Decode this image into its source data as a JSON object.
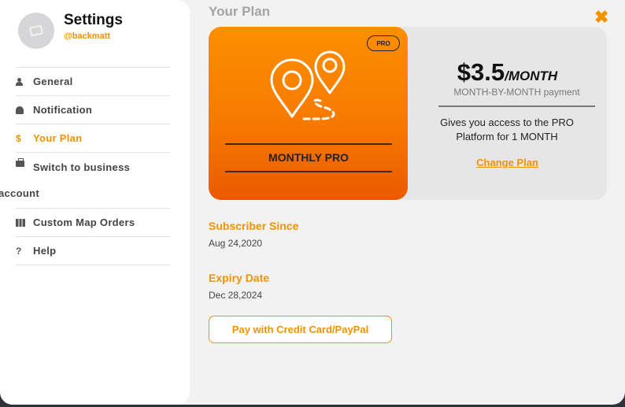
{
  "sidebar": {
    "title": "Settings",
    "username": "@backmatt",
    "items": [
      {
        "label": "General",
        "icon": "user-icon"
      },
      {
        "label": "Notification",
        "icon": "bell-icon"
      },
      {
        "label": "Your Plan",
        "icon": "dollar-icon",
        "glyph": "$"
      },
      {
        "label": "Switch to business",
        "label2": "account",
        "icon": "briefcase-icon"
      },
      {
        "label": "Custom Map Orders",
        "icon": "map-icon"
      },
      {
        "label": "Help",
        "icon": "question-icon",
        "glyph": "?"
      }
    ]
  },
  "main": {
    "title": "Your Plan",
    "close_glyph": "✖",
    "plan": {
      "badge": "PRO",
      "name": "MONTHLY PRO",
      "price": "$3.5",
      "per": "/MONTH",
      "billing": "MONTH-BY-MONTH payment",
      "description": "Gives you access to the PRO Platform for 1 MONTH",
      "change_label": "Change Plan"
    },
    "subscriber_since_label": "Subscriber Since",
    "subscriber_since_value": "Aug 24,2020",
    "expiry_label": "Expiry Date",
    "expiry_value": "Dec 28,2024",
    "pay_button": "Pay with Credit Card/PayPal"
  },
  "colors": {
    "accent": "#f39200",
    "plan_gradient_top": "#fd8f00",
    "plan_gradient_bottom": "#e95a00"
  }
}
